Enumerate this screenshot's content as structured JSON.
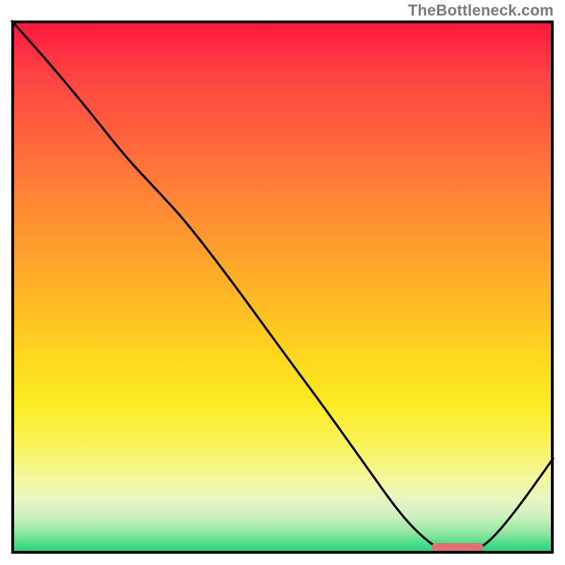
{
  "attribution": "TheBottleneck.com",
  "colors": {
    "gradient_top": "#ff163e",
    "gradient_bottom": "#18d57c",
    "curve": "#000000",
    "border": "#000000",
    "marker": "#e17070",
    "attribution_text": "#7a7a7a"
  },
  "chart_data": {
    "type": "line",
    "title": "",
    "xlabel": "",
    "ylabel": "",
    "xlim": [
      0,
      100
    ],
    "ylim": [
      0,
      100
    ],
    "grid": false,
    "series": [
      {
        "name": "curve",
        "points": [
          {
            "x": 0.0,
            "y": 100.0
          },
          {
            "x": 7.0,
            "y": 92.0
          },
          {
            "x": 14.0,
            "y": 83.5
          },
          {
            "x": 21.0,
            "y": 74.5
          },
          {
            "x": 27.0,
            "y": 68.0
          },
          {
            "x": 32.0,
            "y": 62.5
          },
          {
            "x": 40.0,
            "y": 52.0
          },
          {
            "x": 50.0,
            "y": 38.0
          },
          {
            "x": 58.0,
            "y": 27.0
          },
          {
            "x": 65.0,
            "y": 17.0
          },
          {
            "x": 72.0,
            "y": 7.0
          },
          {
            "x": 77.0,
            "y": 2.0
          },
          {
            "x": 80.0,
            "y": 0.5
          },
          {
            "x": 85.0,
            "y": 0.5
          },
          {
            "x": 88.0,
            "y": 2.0
          },
          {
            "x": 93.0,
            "y": 8.0
          },
          {
            "x": 100.0,
            "y": 18.0
          }
        ]
      }
    ],
    "marker": {
      "x_start": 77.5,
      "x_end": 87.0,
      "y": 1.2,
      "thickness_pct": 1.6
    }
  }
}
